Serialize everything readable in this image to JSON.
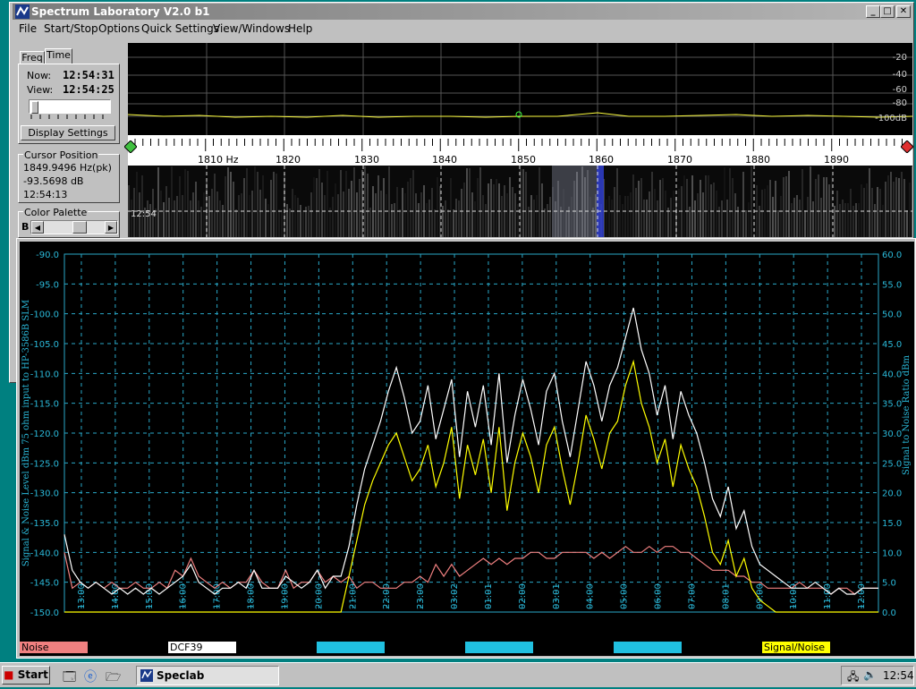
{
  "window": {
    "title": "Spectrum Laboratory V2.0 b1",
    "min": "_",
    "max": "□",
    "close": "✕"
  },
  "menu": [
    "File",
    "Start/Stop",
    "Options",
    "Quick Settings",
    "View/Windows",
    "Help"
  ],
  "left_panel": {
    "tabs": [
      "Freq",
      "Time"
    ],
    "now_label": "Now:",
    "now_value": "12:54:31",
    "view_label": "View:",
    "view_value": "12:54:25",
    "display_settings": "Display Settings",
    "cursor_title": "Cursor Position",
    "cursor_freq": "1849.9496 Hz(pk)",
    "cursor_db": "-93.5698 dB",
    "cursor_time": "12:54:13",
    "palette_title": "Color Palette",
    "palette_b": "B"
  },
  "spectrum": {
    "db_ticks": [
      "-20",
      "-40",
      "-60",
      "-80",
      "-100dB"
    ],
    "freq_ticks": [
      "1810 Hz",
      "1820",
      "1830",
      "1840",
      "1850",
      "1860",
      "1870",
      "1880",
      "1890"
    ],
    "waterfall_time": "12:54"
  },
  "chart_data": {
    "type": "line",
    "ylabel": "Signal & Noise Level dBm 75 ohm input to HP-3586B SLM",
    "y2label": "Signal to Noise Ratio  dBm",
    "ylim": [
      -150,
      -90
    ],
    "y2lim": [
      0,
      60
    ],
    "y_ticks": [
      "-90.0",
      "-95.0",
      "-100.0",
      "-105.0",
      "-110.0",
      "-115.0",
      "-120.0",
      "-125.0",
      "-130.0",
      "-135.0",
      "-140.0",
      "-145.0",
      "-150.0"
    ],
    "y2_ticks": [
      "60.0",
      "55.0",
      "50.0",
      "45.0",
      "40.0",
      "35.0",
      "30.0",
      "25.0",
      "20.0",
      "15.0",
      "10.0",
      "5.0",
      "0.0"
    ],
    "x_ticks": [
      "13:00",
      "14:00",
      "15:00",
      "16:00",
      "17:00",
      "18:00",
      "19:00",
      "20:00",
      "21:00",
      "22:00",
      "23:00",
      "03:02",
      "01:01",
      "02:00",
      "03:01",
      "04:00",
      "05:00",
      "06:00",
      "07:00",
      "08:01",
      "09:00",
      "10:00",
      "11:00",
      "12:00"
    ],
    "series": [
      {
        "name": "Noise",
        "color": "#f08080",
        "values": [
          -140,
          -146,
          -145,
          -146,
          -145,
          -146,
          -145,
          -146,
          -146,
          -145,
          -146,
          -146,
          -145,
          -146,
          -143,
          -144,
          -141,
          -144,
          -145,
          -146,
          -145,
          -146,
          -145,
          -145,
          -143,
          -145,
          -146,
          -146,
          -143,
          -146,
          -145,
          -145,
          -143,
          -145,
          -144,
          -145,
          -144,
          -146,
          -145,
          -145,
          -146,
          -146,
          -146,
          -145,
          -145,
          -144,
          -145,
          -142,
          -144,
          -142,
          -144,
          -143,
          -142,
          -141,
          -142,
          -141,
          -142,
          -141,
          -141,
          -140,
          -140,
          -141,
          -141,
          -140,
          -140,
          -140,
          -140,
          -141,
          -140,
          -141,
          -140,
          -139,
          -140,
          -140,
          -139,
          -140,
          -139,
          -139,
          -140,
          -140,
          -141,
          -142,
          -143,
          -143,
          -143,
          -144,
          -144,
          -145,
          -145,
          -146,
          -146,
          -146,
          -146,
          -145,
          -146,
          -146,
          -146,
          -147,
          -146,
          -146,
          -147,
          -146,
          -146,
          -146
        ]
      },
      {
        "name": "DCF39",
        "color": "#ffffff",
        "values": [
          -137,
          -143,
          -145,
          -146,
          -145,
          -146,
          -147,
          -146,
          -147,
          -146,
          -147,
          -146,
          -147,
          -146,
          -145,
          -144,
          -142,
          -145,
          -146,
          -147,
          -146,
          -146,
          -145,
          -146,
          -143,
          -146,
          -146,
          -146,
          -144,
          -145,
          -146,
          -145,
          -143,
          -146,
          -144,
          -144,
          -139,
          -132,
          -126,
          -122,
          -118,
          -113,
          -109,
          -114,
          -120,
          -118,
          -112,
          -121,
          -116,
          -111,
          -124,
          -113,
          -119,
          -112,
          -122,
          -110,
          -125,
          -117,
          -111,
          -116,
          -122,
          -113,
          -110,
          -118,
          -124,
          -116,
          -108,
          -112,
          -118,
          -112,
          -109,
          -104,
          -99,
          -106,
          -110,
          -117,
          -112,
          -121,
          -113,
          -117,
          -120,
          -125,
          -131,
          -134,
          -129,
          -136,
          -133,
          -139,
          -142,
          -143,
          -144,
          -145,
          -146,
          -146,
          -146,
          -145,
          -146,
          -147,
          -146,
          -147,
          -147,
          -146,
          -146,
          -146
        ]
      },
      {
        "name": "Signal/Noise",
        "color": "#ffff00",
        "values": [
          0,
          0,
          0,
          0,
          0,
          0,
          0,
          0,
          0,
          0,
          0,
          0,
          0,
          0,
          0,
          0,
          0,
          0,
          0,
          0,
          0,
          0,
          0,
          0,
          0,
          0,
          0,
          0,
          0,
          0,
          0,
          0,
          0,
          0,
          0,
          0,
          6,
          12,
          18,
          22,
          25,
          28,
          30,
          26,
          22,
          24,
          28,
          21,
          25,
          31,
          19,
          28,
          23,
          29,
          20,
          31,
          17,
          25,
          30,
          26,
          20,
          28,
          31,
          24,
          18,
          25,
          33,
          29,
          24,
          30,
          32,
          38,
          42,
          35,
          31,
          25,
          29,
          21,
          28,
          24,
          21,
          16,
          10,
          8,
          12,
          6,
          9,
          4,
          2,
          1,
          0,
          0,
          0,
          0,
          0,
          0,
          0,
          0,
          0,
          0,
          0,
          0,
          0,
          0
        ]
      }
    ],
    "legend": [
      "Noise",
      "DCF39",
      "",
      "",
      "",
      "Signal/Noise"
    ],
    "grid": true
  },
  "taskbar": {
    "start": "Start",
    "task": "Speclab",
    "clock": "12:54"
  }
}
